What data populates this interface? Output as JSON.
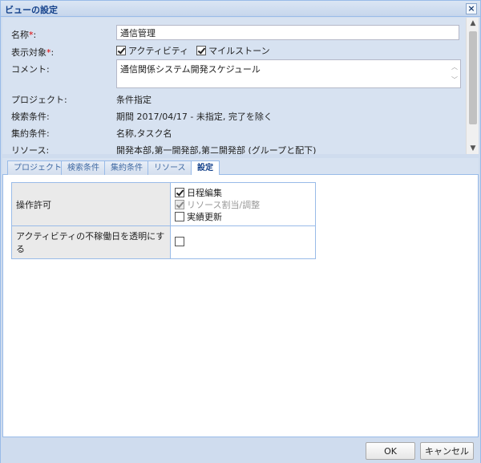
{
  "window": {
    "title": "ビューの設定",
    "close_glyph": "×"
  },
  "form": {
    "name_label": "名称",
    "name_value": "通信管理",
    "target_label": "表示対象",
    "required_mark": "*",
    "colon": ":",
    "target_options": [
      {
        "label": "アクティビティ",
        "checked": true
      },
      {
        "label": "マイルストーン",
        "checked": true
      }
    ],
    "comment_label": "コメント:",
    "comment_value": "通信関係システム開発スケジュール",
    "project_label": "プロジェクト:",
    "project_value": "条件指定",
    "search_label": "検索条件:",
    "search_value": "期間 2017/04/17 - 未指定, 完了を除く",
    "aggregate_label": "集約条件:",
    "aggregate_value": "名称,タスク名",
    "resource_label": "リソース:",
    "resource_value": "開発本部,第一開発部,第二開発部 (グループと配下)"
  },
  "tabs": [
    {
      "label": "プロジェクト",
      "active": false
    },
    {
      "label": "検索条件",
      "active": false
    },
    {
      "label": "集約条件",
      "active": false
    },
    {
      "label": "リソース",
      "active": false
    },
    {
      "label": "設定",
      "active": true
    }
  ],
  "settings": {
    "permission_label": "操作許可",
    "permission_options": [
      {
        "label": "日程編集",
        "checked": true,
        "disabled": false
      },
      {
        "label": "リソース割当/調整",
        "checked": true,
        "disabled": true
      },
      {
        "label": "実績更新",
        "checked": false,
        "disabled": false
      }
    ],
    "transparent_label": "アクティビティの不稼働日を透明にする",
    "transparent_checked": false
  },
  "footer": {
    "ok_label": "OK",
    "cancel_label": "キャンセル"
  }
}
